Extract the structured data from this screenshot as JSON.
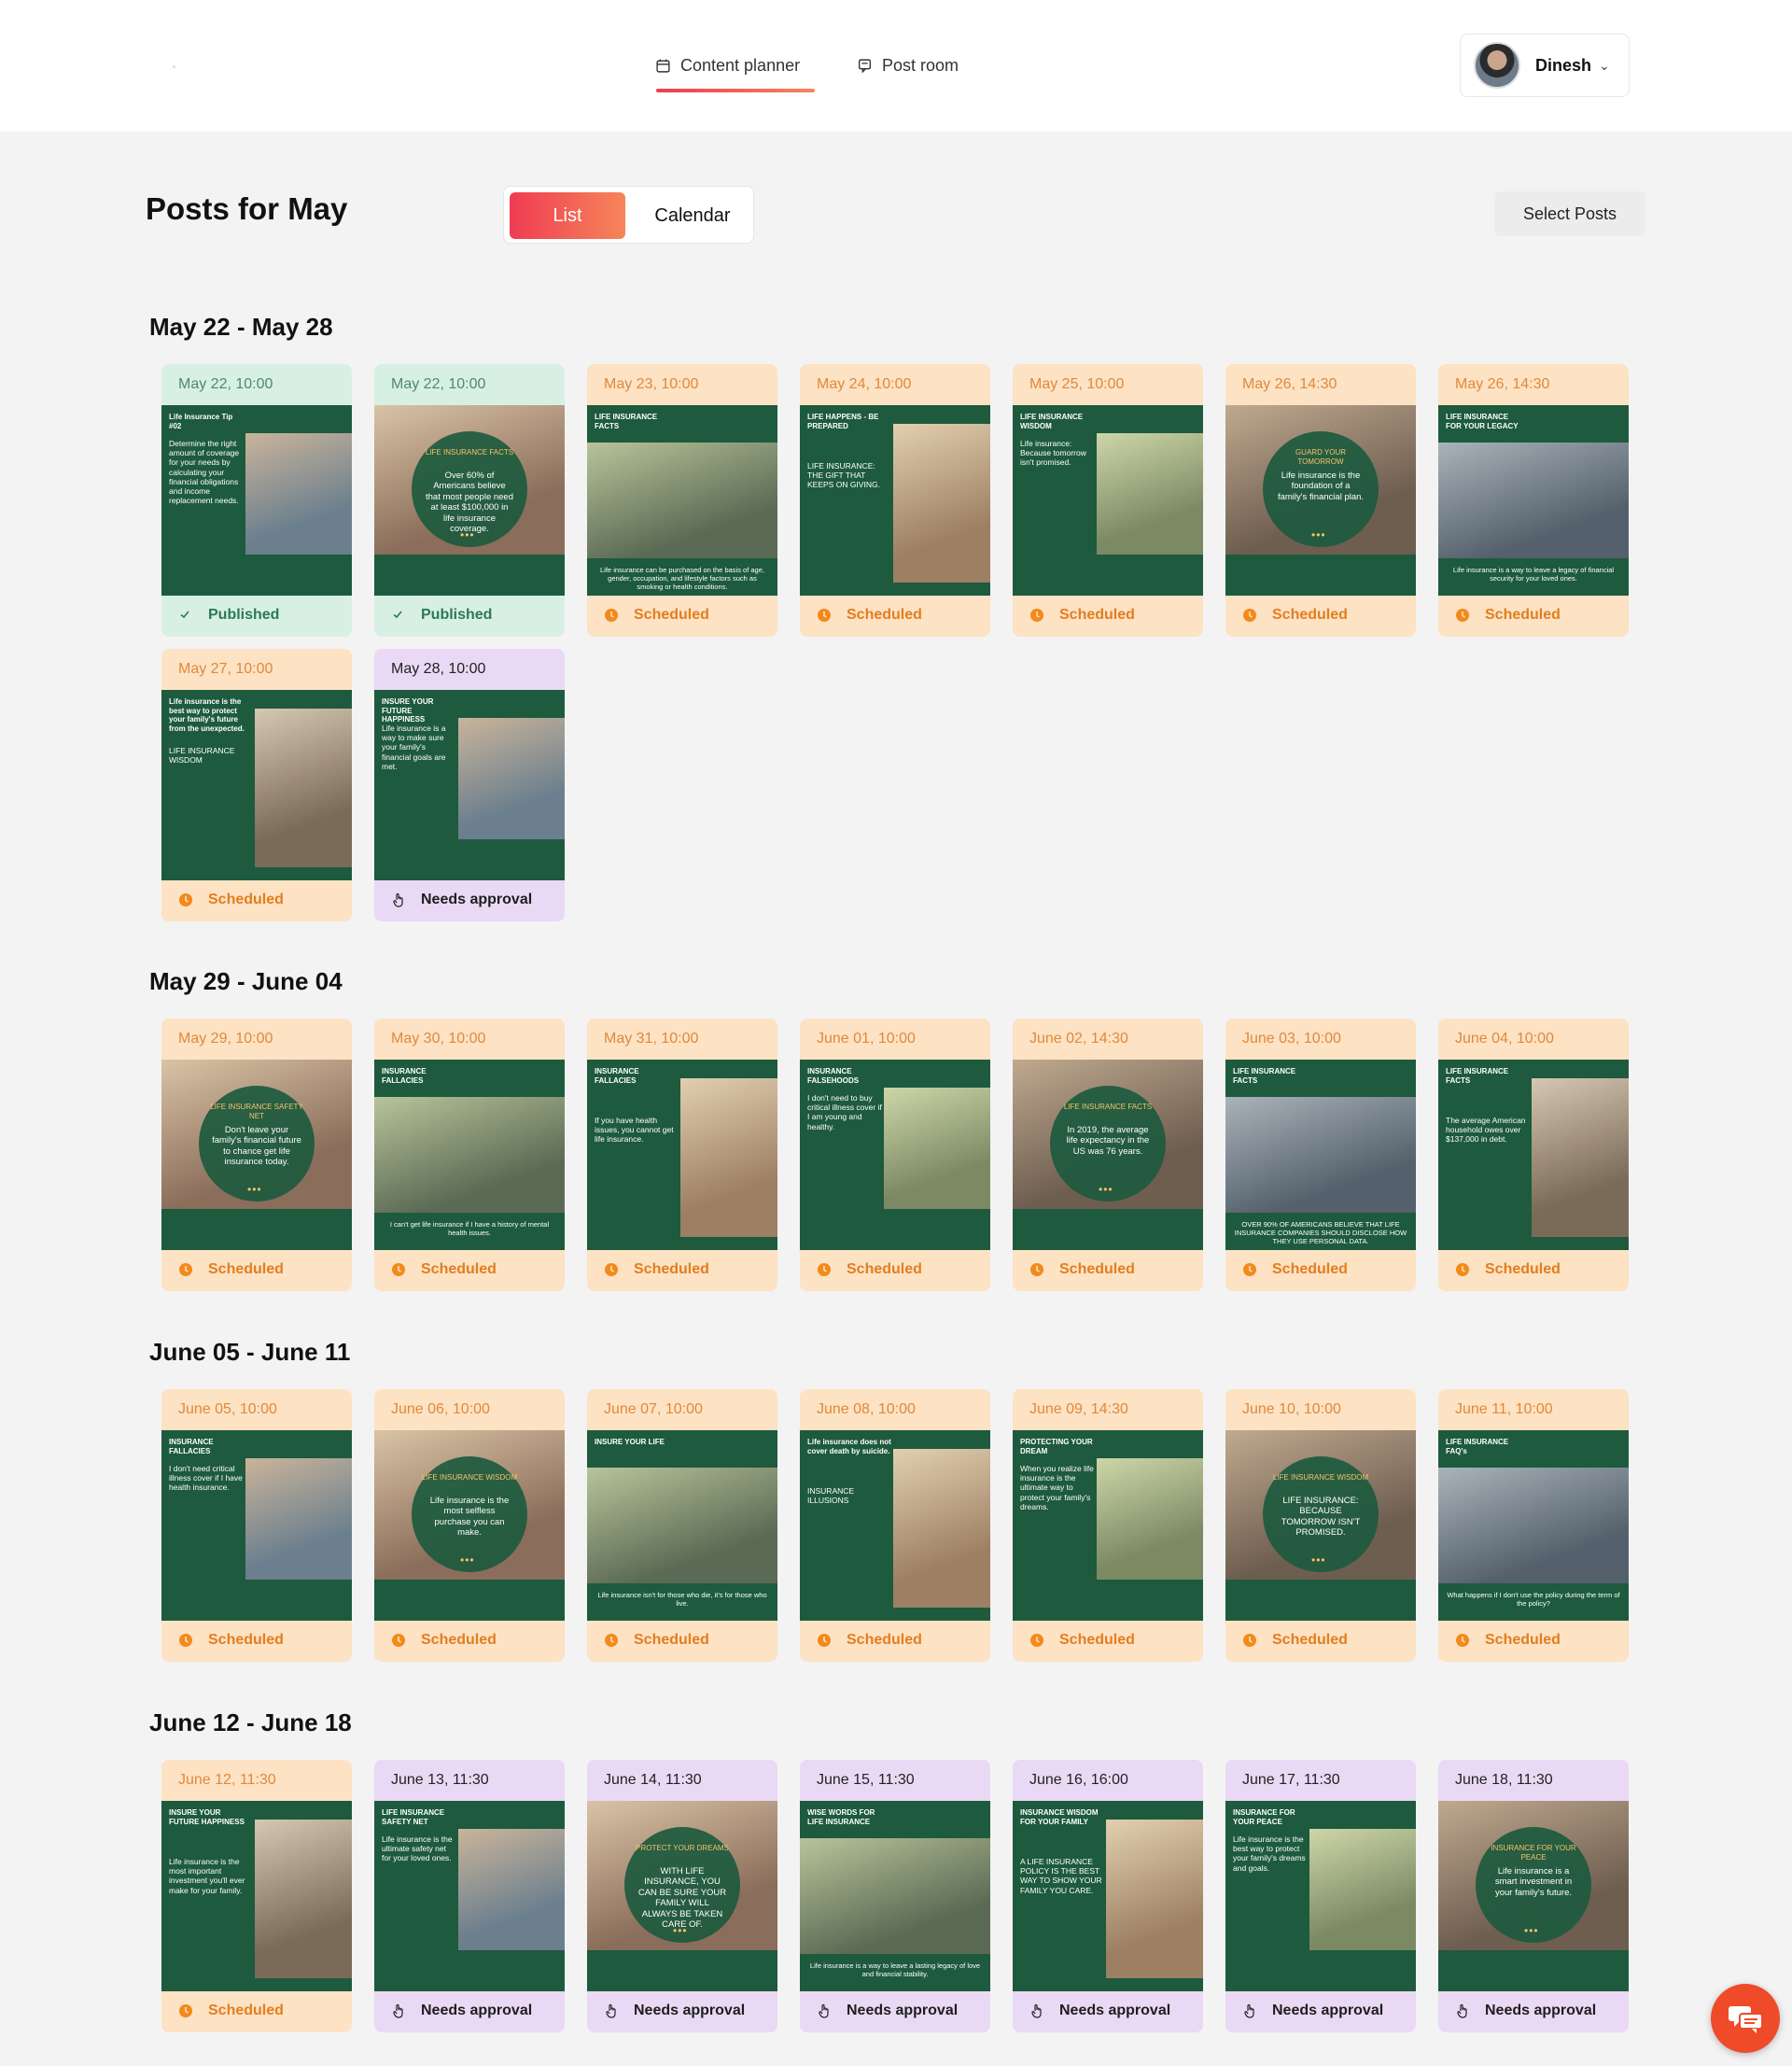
{
  "nav": {
    "tabs": [
      {
        "label": "Content planner",
        "icon": "calendar-icon",
        "active": true
      },
      {
        "label": "Post room",
        "icon": "chat-bubble-icon",
        "active": false
      }
    ],
    "user": {
      "name": "Dinesh"
    }
  },
  "header": {
    "title": "Posts for May",
    "view_toggle": {
      "list": "List",
      "calendar": "Calendar",
      "active": "List"
    },
    "select_posts": "Select Posts"
  },
  "colors": {
    "accent_start": "#ef3c53",
    "accent_end": "#f6855a",
    "published_bg": "#d8f0e4",
    "scheduled_bg": "#fde2c4",
    "approval_bg": "#ead9f5",
    "brand_green": "#1d5a3e"
  },
  "weeks": [
    {
      "title": "May 22 - May 28",
      "posts": [
        {
          "date": "May 22, 10:00",
          "status": "Published",
          "kind": "published",
          "thumb": {
            "heading": "Life Insurance Tip #02",
            "body": "Determine the right amount of coverage for your needs by calculating your financial obligations and income replacement needs."
          }
        },
        {
          "date": "May 22, 10:00",
          "status": "Published",
          "kind": "published",
          "thumb": {
            "heading": "LIFE INSURANCE FACTS",
            "body": "Over 60% of Americans believe that most people need at least $100,000 in life insurance coverage."
          }
        },
        {
          "date": "May 23, 10:00",
          "status": "Scheduled",
          "kind": "scheduled",
          "thumb": {
            "heading": "LIFE INSURANCE FACTS",
            "body": "Life insurance can be purchased on the basis of age, gender, occupation, and lifestyle factors such as smoking or health conditions."
          }
        },
        {
          "date": "May 24, 10:00",
          "status": "Scheduled",
          "kind": "scheduled",
          "thumb": {
            "heading": "LIFE HAPPENS - BE PREPARED",
            "body": "LIFE INSURANCE: THE GIFT THAT KEEPS ON GIVING."
          }
        },
        {
          "date": "May 25, 10:00",
          "status": "Scheduled",
          "kind": "scheduled",
          "thumb": {
            "heading": "LIFE INSURANCE WISDOM",
            "body": "Life insurance: Because tomorrow isn't promised."
          }
        },
        {
          "date": "May 26, 14:30",
          "status": "Scheduled",
          "kind": "scheduled",
          "thumb": {
            "heading": "GUARD YOUR TOMORROW",
            "body": "Life insurance is the foundation of a family's financial plan."
          }
        },
        {
          "date": "May 26, 14:30",
          "status": "Scheduled",
          "kind": "scheduled",
          "thumb": {
            "heading": "LIFE INSURANCE FOR YOUR LEGACY",
            "body": "Life insurance is a way to leave a legacy of financial security for your loved ones."
          }
        },
        {
          "date": "May 27, 10:00",
          "status": "Scheduled",
          "kind": "scheduled",
          "thumb": {
            "heading": "Life insurance is the best way to protect your family's future from the unexpected.",
            "body": "LIFE INSURANCE WISDOM"
          }
        },
        {
          "date": "May 28, 10:00",
          "status": "Needs approval",
          "kind": "approval",
          "thumb": {
            "heading": "INSURE YOUR FUTURE HAPPINESS",
            "body": "Life insurance is a way to make sure your family's financial goals are met."
          }
        }
      ]
    },
    {
      "title": "May 29 - June 04",
      "posts": [
        {
          "date": "May 29, 10:00",
          "status": "Scheduled",
          "kind": "scheduled",
          "thumb": {
            "heading": "LIFE INSURANCE SAFETY NET",
            "body": "Don't leave your family's financial future to chance get life insurance today."
          }
        },
        {
          "date": "May 30, 10:00",
          "status": "Scheduled",
          "kind": "scheduled",
          "thumb": {
            "heading": "INSURANCE FALLACIES",
            "body": "I can't get life insurance if I have a history of mental health issues."
          }
        },
        {
          "date": "May 31, 10:00",
          "status": "Scheduled",
          "kind": "scheduled",
          "thumb": {
            "heading": "INSURANCE FALLACIES",
            "body": "If you have health issues, you cannot get life insurance."
          }
        },
        {
          "date": "June 01, 10:00",
          "status": "Scheduled",
          "kind": "scheduled",
          "thumb": {
            "heading": "INSURANCE FALSEHOODS",
            "body": "I don't need to buy critical illness cover if I am young and healthy."
          }
        },
        {
          "date": "June 02, 14:30",
          "status": "Scheduled",
          "kind": "scheduled",
          "thumb": {
            "heading": "LIFE INSURANCE FACTS",
            "body": "In 2019, the average life expectancy in the US was 76 years."
          }
        },
        {
          "date": "June 03, 10:00",
          "status": "Scheduled",
          "kind": "scheduled",
          "thumb": {
            "heading": "LIFE INSURANCE FACTS",
            "body": "OVER 90% OF AMERICANS BELIEVE THAT LIFE INSURANCE COMPANIES SHOULD DISCLOSE HOW THEY USE PERSONAL DATA."
          }
        },
        {
          "date": "June 04, 10:00",
          "status": "Scheduled",
          "kind": "scheduled",
          "thumb": {
            "heading": "LIFE INSURANCE FACTS",
            "body": "The average American household owes over $137,000 in debt."
          }
        }
      ]
    },
    {
      "title": "June 05 - June 11",
      "posts": [
        {
          "date": "June 05, 10:00",
          "status": "Scheduled",
          "kind": "scheduled",
          "thumb": {
            "heading": "INSURANCE FALLACIES",
            "body": "I don't need critical illness cover if I have health insurance."
          }
        },
        {
          "date": "June 06, 10:00",
          "status": "Scheduled",
          "kind": "scheduled",
          "thumb": {
            "heading": "LIFE INSURANCE WISDOM",
            "body": "Life insurance is the most selfless purchase you can make."
          }
        },
        {
          "date": "June 07, 10:00",
          "status": "Scheduled",
          "kind": "scheduled",
          "thumb": {
            "heading": "INSURE YOUR LIFE",
            "body": "Life insurance isn't for those who die, it's for those who live."
          }
        },
        {
          "date": "June 08, 10:00",
          "status": "Scheduled",
          "kind": "scheduled",
          "thumb": {
            "heading": "Life insurance does not cover death by suicide.",
            "body": "INSURANCE ILLUSIONS"
          }
        },
        {
          "date": "June 09, 14:30",
          "status": "Scheduled",
          "kind": "scheduled",
          "thumb": {
            "heading": "PROTECTING YOUR DREAM",
            "body": "When you realize life insurance is the ultimate way to protect your family's dreams."
          }
        },
        {
          "date": "June 10, 10:00",
          "status": "Scheduled",
          "kind": "scheduled",
          "thumb": {
            "heading": "LIFE INSURANCE WISDOM",
            "body": "LIFE INSURANCE: BECAUSE TOMORROW ISN'T PROMISED."
          }
        },
        {
          "date": "June 11, 10:00",
          "status": "Scheduled",
          "kind": "scheduled",
          "thumb": {
            "heading": "LIFE INSURANCE FAQ's",
            "body": "What happens if I don't use the policy during the term of the policy?"
          }
        }
      ]
    },
    {
      "title": "June 12 - June 18",
      "posts": [
        {
          "date": "June 12, 11:30",
          "status": "Scheduled",
          "kind": "scheduled",
          "thumb": {
            "heading": "INSURE YOUR FUTURE HAPPINESS",
            "body": "Life insurance is the most important investment you'll ever make for your family."
          }
        },
        {
          "date": "June 13, 11:30",
          "status": "Needs approval",
          "kind": "approval",
          "thumb": {
            "heading": "LIFE INSURANCE SAFETY NET",
            "body": "Life insurance is the ultimate safety net for your loved ones."
          }
        },
        {
          "date": "June 14, 11:30",
          "status": "Needs approval",
          "kind": "approval",
          "thumb": {
            "heading": "PROTECT YOUR DREAMS",
            "body": "WITH LIFE INSURANCE, YOU CAN BE SURE YOUR FAMILY WILL ALWAYS BE TAKEN CARE OF."
          }
        },
        {
          "date": "June 15, 11:30",
          "status": "Needs approval",
          "kind": "approval",
          "thumb": {
            "heading": "WISE WORDS FOR LIFE INSURANCE",
            "body": "Life insurance is a way to leave a lasting legacy of love and financial stability."
          }
        },
        {
          "date": "June 16, 16:00",
          "status": "Needs approval",
          "kind": "approval",
          "thumb": {
            "heading": "INSURANCE WISDOM FOR YOUR FAMILY",
            "body": "A LIFE INSURANCE POLICY IS THE BEST WAY TO SHOW YOUR FAMILY YOU CARE."
          }
        },
        {
          "date": "June 17, 11:30",
          "status": "Needs approval",
          "kind": "approval",
          "thumb": {
            "heading": "INSURANCE FOR YOUR PEACE",
            "body": "Life insurance is the best way to protect your family's dreams and goals."
          }
        },
        {
          "date": "June 18, 11:30",
          "status": "Needs approval",
          "kind": "approval",
          "thumb": {
            "heading": "INSURANCE FOR YOUR PEACE",
            "body": "Life insurance is a smart investment in your family's future."
          }
        }
      ]
    }
  ]
}
